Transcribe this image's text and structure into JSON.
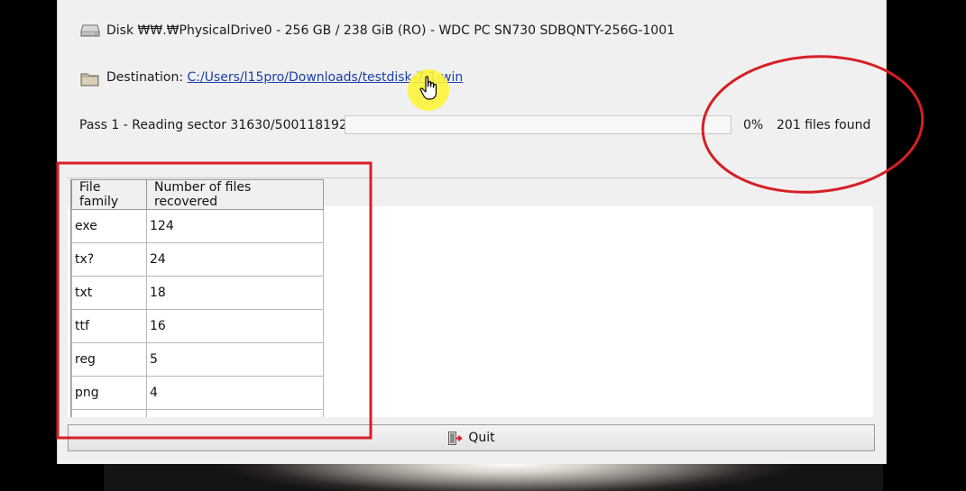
{
  "disk": {
    "label": "Disk ₩₩.₩PhysicalDrive0 - 256 GB / 238 GiB (RO) - WDC PC SN730 SDBQNTY-256G-1001"
  },
  "destination": {
    "label": "Destination: ",
    "path": "C:/Users/l15pro/Downloads/testdisk-7.1-win"
  },
  "progress": {
    "status": "Pass 1 - Reading sector 31630/500118192",
    "percent_text": "0%",
    "percent_value": 0,
    "files_found": "201 files found"
  },
  "table": {
    "headers": [
      "File family",
      "Number of files recovered"
    ],
    "rows": [
      [
        "exe",
        "124"
      ],
      [
        "tx?",
        "24"
      ],
      [
        "txt",
        "18"
      ],
      [
        "ttf",
        "16"
      ],
      [
        "reg",
        "5"
      ],
      [
        "png",
        "4"
      ],
      [
        "",
        ""
      ]
    ]
  },
  "quit": {
    "label": "Quit"
  },
  "colors": {
    "annotation_red": "#d61f26",
    "link_blue": "#1a3fa8",
    "cursor_highlight": "#fbf43a"
  },
  "icons": [
    "disk-icon",
    "folder-icon",
    "hand-pointer-icon",
    "quit-icon"
  ]
}
